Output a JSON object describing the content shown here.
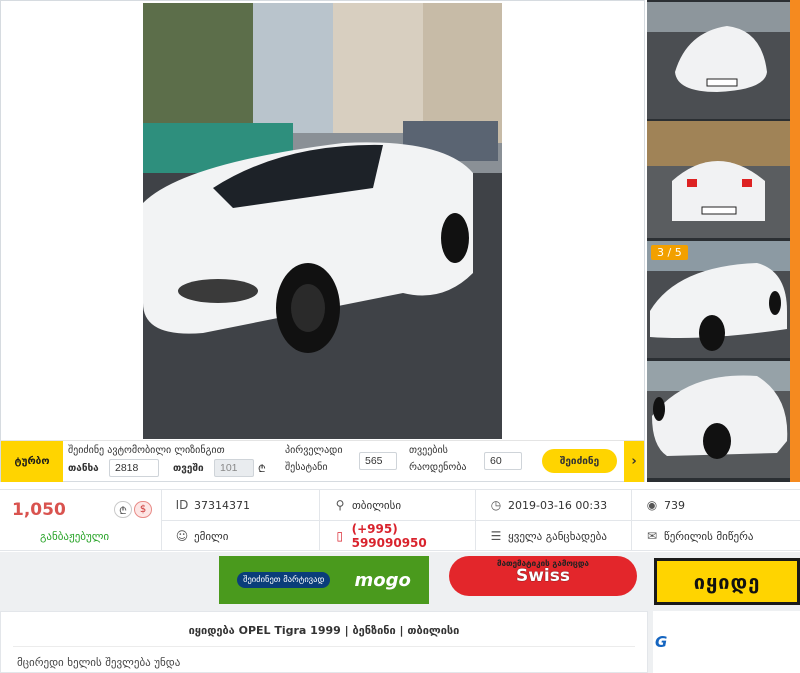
{
  "turbo": {
    "logo": "ტურბო",
    "search_label": "შეიძინე ავტომობილი ლიზინგით",
    "amount_label": "თანხა",
    "amount_value": "2818",
    "month_label": "თვეში",
    "month_value": "101",
    "initial_label_1": "პირველადი",
    "initial_label_2": "შესატანი",
    "initial_value": "565",
    "months_label_1": "თვეების",
    "months_label_2": "რაოდენობა",
    "months_value": "60",
    "button": "შეიძინე",
    "next": "›"
  },
  "gallery": {
    "counter": "3 / 5",
    "thumb_count": 4
  },
  "listing": {
    "price": "1,050",
    "currency_gel": "₾",
    "currency_usd": "$",
    "customs_status": "განბაჟებული",
    "id_label": "ID",
    "id": "37314371",
    "location": "თბილისი",
    "date": "2019-03-16 00:33",
    "views": "739",
    "seller": "ემილი",
    "phone": "(+995) 599090950",
    "all_listings": "ყველა განცხადება",
    "write_message": "წერილის მიწერა"
  },
  "ads": {
    "mogo_text": "შეიძინეთ მარტივად",
    "mogo_brand": "mogo",
    "swiss_top": "მათემატიკის გამოცდა",
    "swiss_main": "Swiss",
    "buy_text": "იყიდე"
  },
  "description": {
    "title": "იყიდება OPEL Tigra 1999 | ბენზინი | თბილისი",
    "text": "მცირედი ხელის შევლება უნდა",
    "side_logo": "G"
  },
  "colors": {
    "accent": "#ffd400",
    "price": "#d9534f",
    "customs": "#27a327",
    "phone": "#d9232d"
  }
}
